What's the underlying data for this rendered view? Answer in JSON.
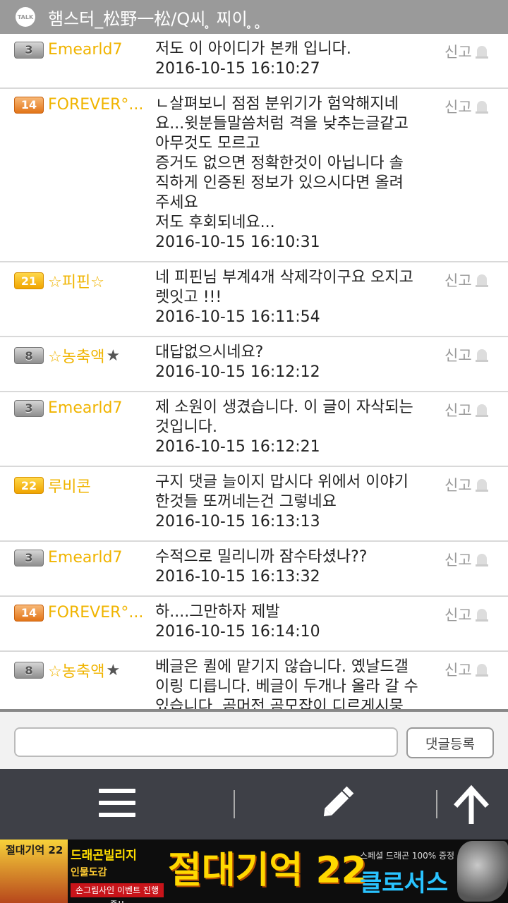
{
  "header": {
    "icon_text": "TALK",
    "title": "햄스터_松野一松/Q씨 ̥ 찌이 ̥˳"
  },
  "comments": [
    {
      "level": "3",
      "level_color": "gray",
      "user": "Emearld7",
      "star": false,
      "message": "저도 이 아이디가 본캐 입니다.",
      "time": "2016-10-15 16:10:27",
      "report": "신고"
    },
    {
      "level": "14",
      "level_color": "orange",
      "user": "FOREVER°...",
      "star": false,
      "message": "ㄴ살펴보니 점점 분위기가 험악해지네\n요...윗분들말씀처럼 격을 낮추는글같고\n아무것도 모르고\n증거도 없으면 정확한것이 아닙니다 솔\n직하게 인증된 정보가 있으시다면 올려\n주세요\n저도 후회되네요...",
      "time": "2016-10-15 16:10:31",
      "report": "신고"
    },
    {
      "level": "21",
      "level_color": "yellow",
      "user": "☆피핀☆",
      "star": false,
      "message": "네 피핀님 부계4개 삭제각이구요 오지고\n렛잇고 !!!",
      "time": "2016-10-15 16:11:54",
      "report": "신고"
    },
    {
      "level": "8",
      "level_color": "gray",
      "user": "☆농축액",
      "star": true,
      "message": "대답없으시네요?",
      "time": "2016-10-15 16:12:12",
      "report": "신고"
    },
    {
      "level": "3",
      "level_color": "gray",
      "user": "Emearld7",
      "star": false,
      "message": "제 소원이 생겼습니다. 이 글이 자삭되는\n것입니다.",
      "time": "2016-10-15 16:12:21",
      "report": "신고"
    },
    {
      "level": "22",
      "level_color": "yellow",
      "user": "루비콘",
      "star": false,
      "message": "구지 댓글 늘이지 맙시다 위에서 이야기\n한것들 또꺼네는건 그렇네요",
      "time": "2016-10-15 16:13:13",
      "report": "신고"
    },
    {
      "level": "3",
      "level_color": "gray",
      "user": "Emearld7",
      "star": false,
      "message": "수적으로 밀리니까 잠수타셨나??",
      "time": "2016-10-15 16:13:32",
      "report": "신고"
    },
    {
      "level": "14",
      "level_color": "orange",
      "user": "FOREVER°...",
      "star": false,
      "message": "하....그만하자 제발",
      "time": "2016-10-15 16:14:10",
      "report": "신고"
    },
    {
      "level": "8",
      "level_color": "gray",
      "user": "☆농축액",
      "star": true,
      "message": "베글은 퀼에 맡기지 않습니다. 옜날드갤\n이링 디릅니다. 베글이 두개나 올라 갈 수\n있습니다. 곰머전 곰모잡이 디르게시뭉",
      "time": "",
      "report": "신고"
    }
  ],
  "comment_bar": {
    "placeholder": "",
    "submit_label": "댓글등록"
  },
  "bottom_bar": {
    "icons": [
      "menu-icon",
      "pencil-icon",
      "arrow-up-icon"
    ]
  },
  "ad": {
    "left_title": "절대기억 22",
    "brand": "드래곤빌리지",
    "sub": "인물도감",
    "event": "손그림사인 이벤트 진행중!!",
    "main": "절대기억 22",
    "tag": "스페셜 드래곤 100% 증정",
    "cross": "클로서스"
  },
  "colors": {
    "header": "#9a9a9a",
    "username": "#f0b400",
    "bottom_bar": "#3e4047",
    "report": "#999999"
  }
}
